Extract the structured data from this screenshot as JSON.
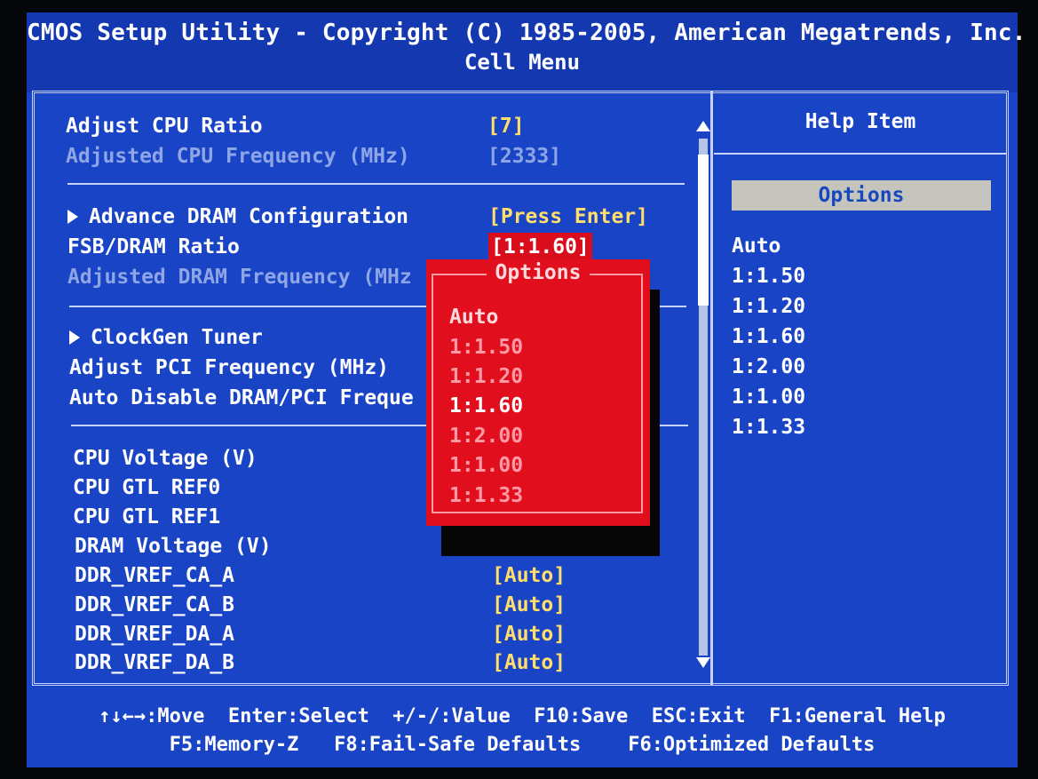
{
  "header": {
    "title": "CMOS Setup Utility - Copyright (C) 1985-2005, American Megatrends, Inc.",
    "menu": "Cell Menu"
  },
  "settings": [
    {
      "label": "Adjust CPU Ratio",
      "value": "[7]"
    },
    {
      "label": "Adjusted CPU Frequency (MHz)",
      "value": "[2333]"
    },
    {
      "label": "Advance DRAM Configuration",
      "value": "[Press Enter]"
    },
    {
      "label": "FSB/DRAM Ratio",
      "value": "[1:1.60]"
    },
    {
      "label": "Adjusted DRAM Frequency (MHz"
    },
    {
      "label": "ClockGen Tuner"
    },
    {
      "label": "Adjust PCI Frequency (MHz)"
    },
    {
      "label": "Auto Disable DRAM/PCI Freque"
    },
    {
      "label": "CPU Voltage (V)"
    },
    {
      "label": "CPU GTL REF0"
    },
    {
      "label": "CPU GTL REF1"
    },
    {
      "label": "DRAM Voltage (V)",
      "value": "[Auto]"
    },
    {
      "label": "DDR_VREF_CA_A",
      "value": "[Auto]"
    },
    {
      "label": "DDR_VREF_CA_B",
      "value": "[Auto]"
    },
    {
      "label": "DDR_VREF_DA_A",
      "value": "[Auto]"
    },
    {
      "label": "DDR_VREF_DA_B",
      "value": "[Auto]"
    }
  ],
  "popup": {
    "title": "Options",
    "options": [
      "Auto",
      "1:1.50",
      "1:1.20",
      "1:1.60",
      "1:2.00",
      "1:1.00",
      "1:1.33"
    ],
    "selected": "1:1.60"
  },
  "help": {
    "title": "Help Item",
    "options_header": "Options",
    "options": [
      "Auto",
      "1:1.50",
      "1:1.20",
      "1:1.60",
      "1:2.00",
      "1:1.00",
      "1:1.33"
    ]
  },
  "footer": {
    "line1": "↑↓←→:Move  Enter:Select  +/-/:Value  F10:Save  ESC:Exit  F1:General Help",
    "line2": "F5:Memory-Z   F8:Fail-Safe Defaults    F6:Optimized Defaults"
  },
  "colors": {
    "background": "#1a44c6",
    "value_text": "#ffde6b",
    "popup_bg": "#e10f1e",
    "selected_value_bg": "#d90d1c"
  }
}
